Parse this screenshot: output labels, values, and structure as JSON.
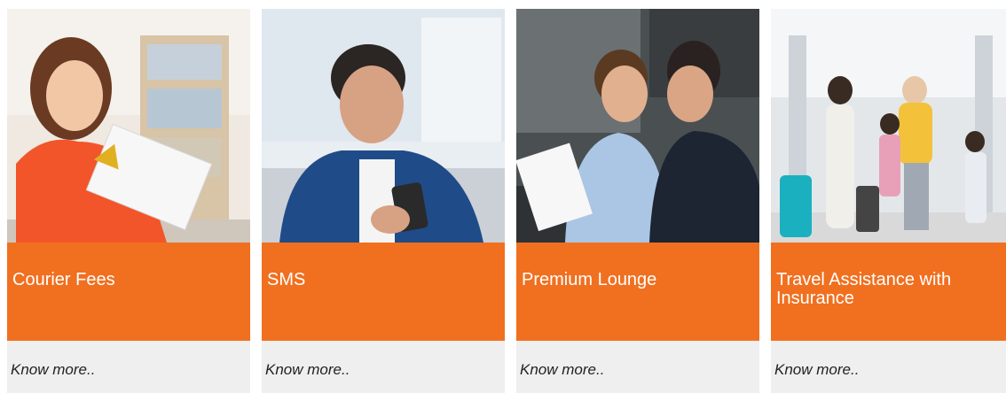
{
  "theme": {
    "accent": "#f07020",
    "card_footer_bg": "#efefef"
  },
  "cards": [
    {
      "title": "Courier Fees",
      "link": "Know more..",
      "image": "woman-with-envelope-photo"
    },
    {
      "title": "SMS",
      "link": "Know more..",
      "image": "man-using-smartphone-photo"
    },
    {
      "title": "Premium Lounge",
      "link": "Know more..",
      "image": "businessmen-meeting-photo"
    },
    {
      "title": "Travel Assistance with Insurance",
      "link": "Know more..",
      "image": "family-airport-travel-photo"
    }
  ]
}
